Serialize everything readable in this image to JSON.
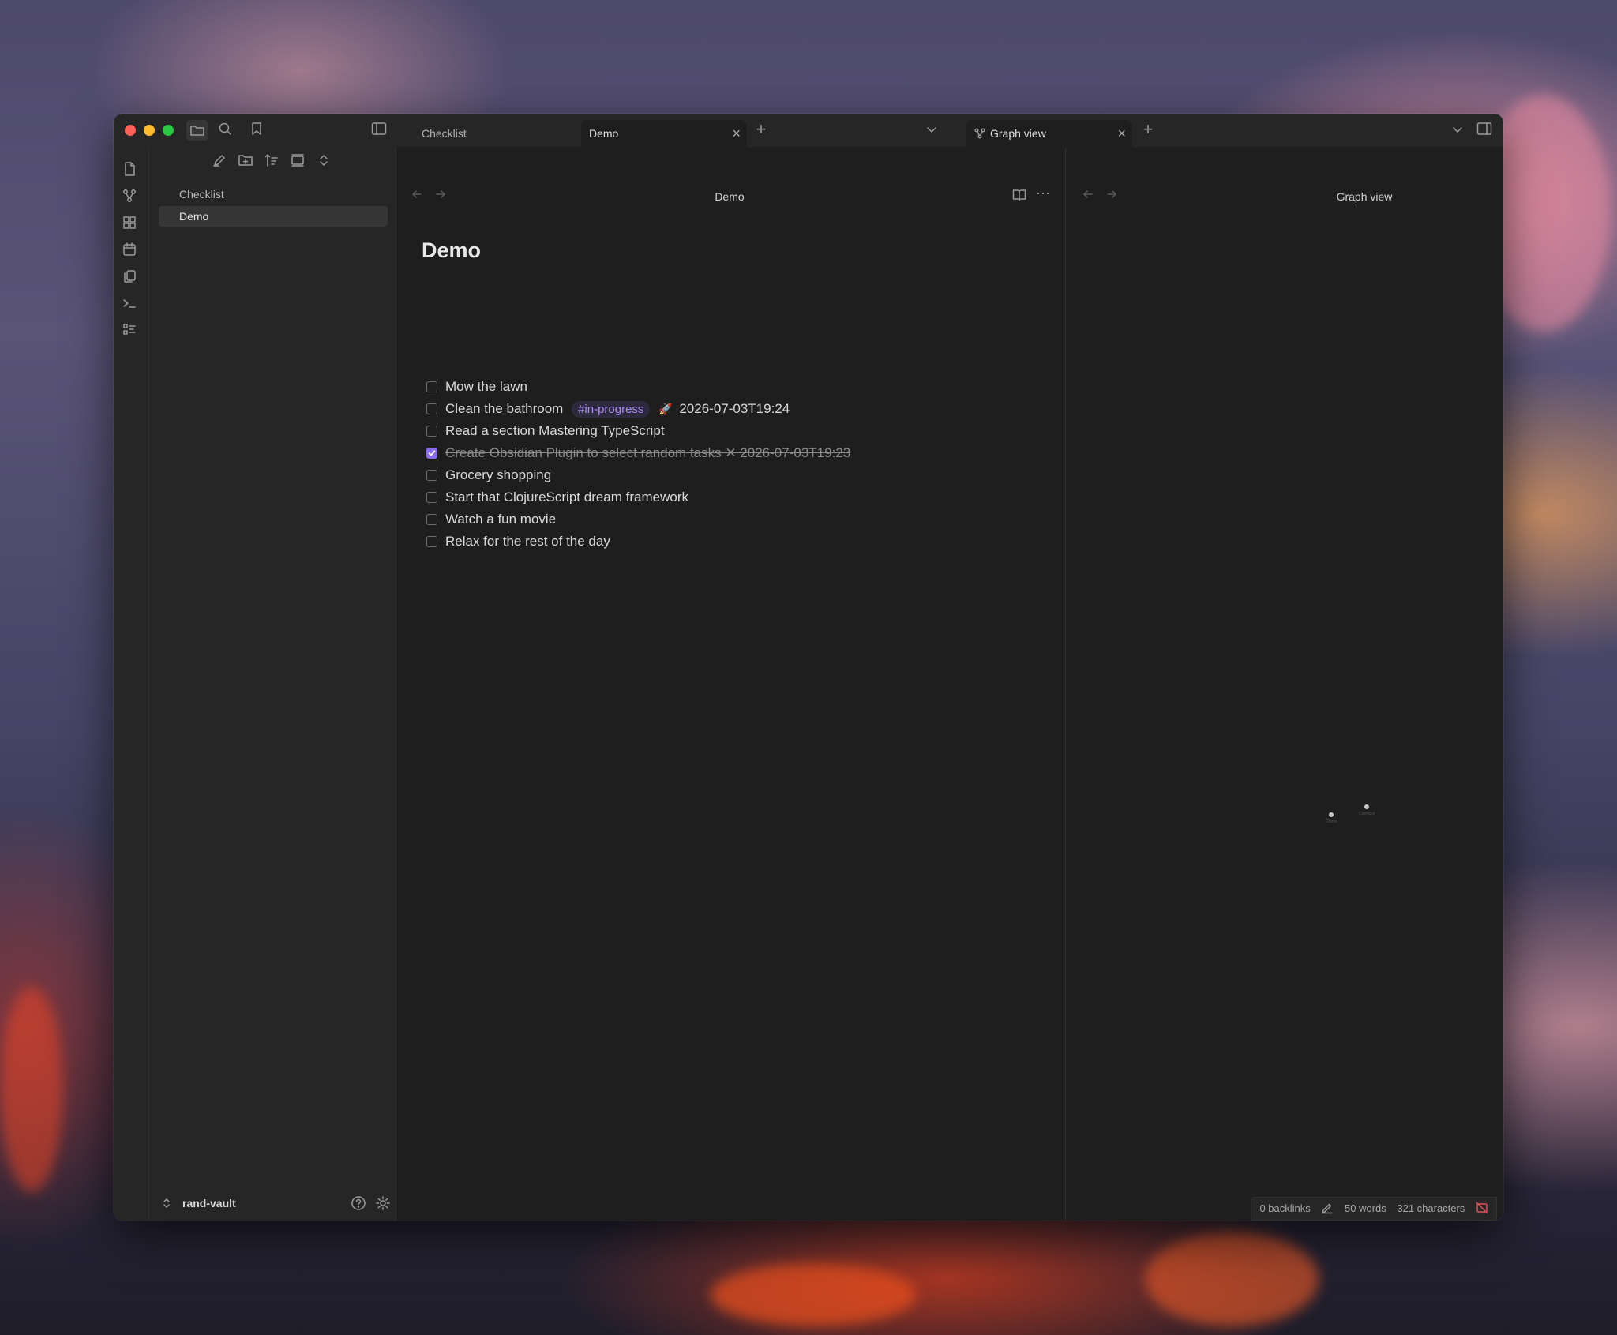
{
  "window": {
    "traffic_lights": {
      "close": "#ff5f57",
      "minimize": "#febc2e",
      "maximize": "#28c840"
    },
    "accent": "#8b6cf0"
  },
  "tabs_left": [
    {
      "label": "Checklist"
    },
    {
      "label": "Demo"
    }
  ],
  "tabs_right": [
    {
      "label": "Graph view"
    }
  ],
  "sidebar": {
    "files": [
      {
        "label": "Checklist"
      },
      {
        "label": "Demo"
      }
    ],
    "vault_name": "rand-vault"
  },
  "editor": {
    "header_title": "Demo",
    "note_title": "Demo",
    "tasks": [
      {
        "text": "Mow the lawn",
        "done": false
      },
      {
        "text": "Clean the bathroom",
        "tag": "#in-progress",
        "rocket": "🚀",
        "date": "2026-07-03T19:24",
        "done": false
      },
      {
        "text": "Read a section Mastering TypeScript",
        "done": false
      },
      {
        "text": "Create Obsidian Plugin to select random tasks ✕ 2026-07-03T19:23",
        "done": true
      },
      {
        "text": "Grocery shopping",
        "done": false
      },
      {
        "text": "Start that ClojureScript dream framework",
        "done": false
      },
      {
        "text": "Watch a fun movie",
        "done": false
      },
      {
        "text": "Relax for the rest of the day",
        "done": false
      }
    ]
  },
  "graph": {
    "header_title": "Graph view",
    "nodes": [
      {
        "label": "Demo"
      },
      {
        "label": "Checklist"
      }
    ]
  },
  "statusbar": {
    "backlinks": "0 backlinks",
    "words": "50 words",
    "characters": "321 characters"
  }
}
